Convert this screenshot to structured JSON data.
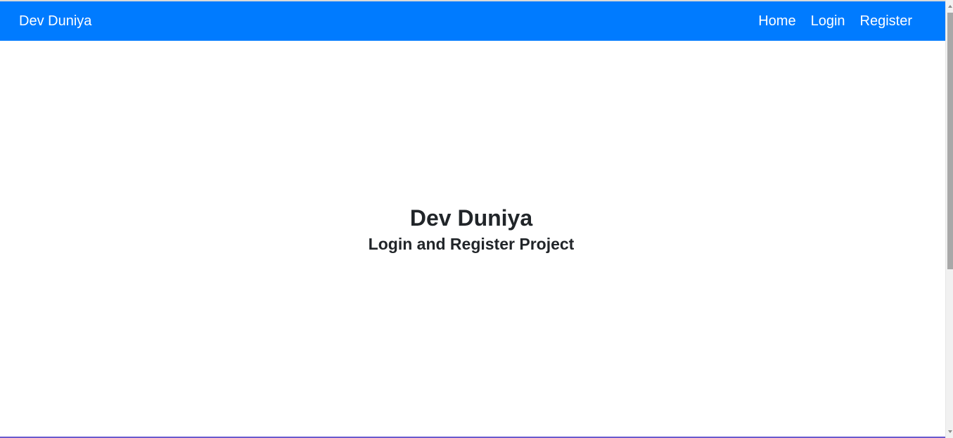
{
  "navbar": {
    "brand": "Dev Duniya",
    "links": [
      {
        "label": "Home"
      },
      {
        "label": "Login"
      },
      {
        "label": "Register"
      }
    ],
    "color": "#007bff"
  },
  "hero": {
    "title": "Dev Duniya",
    "subtitle": "Login and Register Project"
  },
  "icons": [
    "scroll-up-arrow-icon",
    "scroll-down-arrow-icon"
  ]
}
